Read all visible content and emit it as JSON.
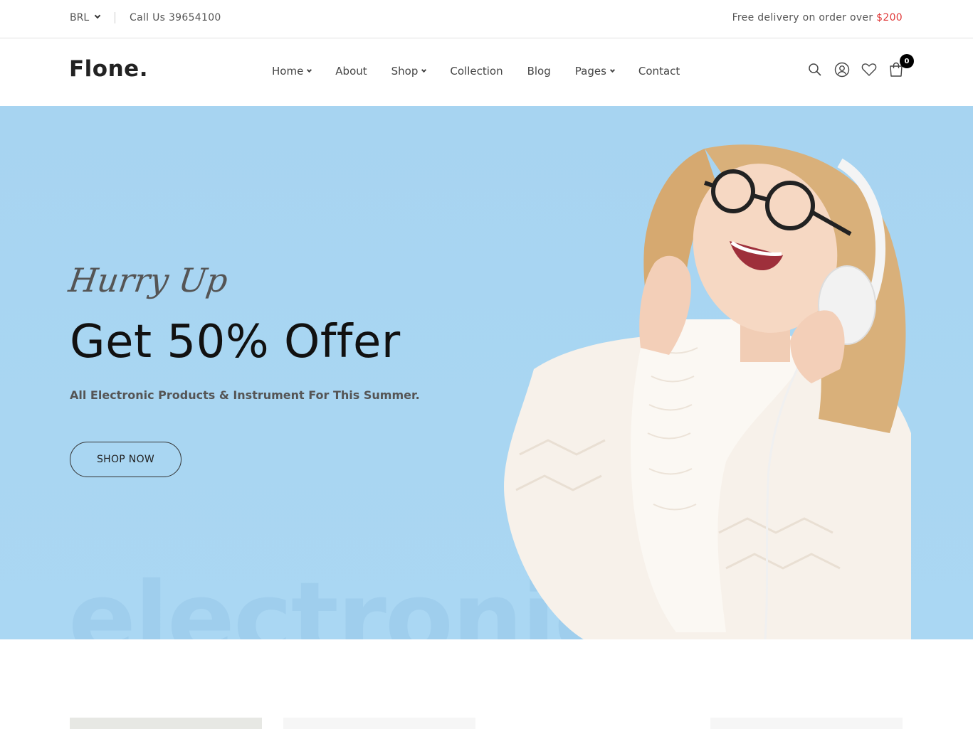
{
  "topbar": {
    "currency": "BRL",
    "phone_text": "Call Us 39654100",
    "delivery_text": "Free delivery on order over ",
    "delivery_amount": "$200",
    "accent_color": "#e03a3a"
  },
  "header": {
    "logo": "Flone.",
    "nav": [
      {
        "label": "Home",
        "has_dropdown": true
      },
      {
        "label": "About",
        "has_dropdown": false
      },
      {
        "label": "Shop",
        "has_dropdown": true
      },
      {
        "label": "Collection",
        "has_dropdown": false
      },
      {
        "label": "Blog",
        "has_dropdown": false
      },
      {
        "label": "Pages",
        "has_dropdown": true
      },
      {
        "label": "Contact",
        "has_dropdown": false
      }
    ],
    "icons": [
      "search-icon",
      "user-icon",
      "heart-icon",
      "cart-icon"
    ],
    "cart_count": "0"
  },
  "hero": {
    "script_title": "Hurry Up",
    "title": "Get 50% Offer",
    "subtitle": "All Electronic Products & Instrument For This Summer.",
    "button_label": "SHOP NOW",
    "watermark": "electronic",
    "background_color": "#a9d6f2"
  }
}
